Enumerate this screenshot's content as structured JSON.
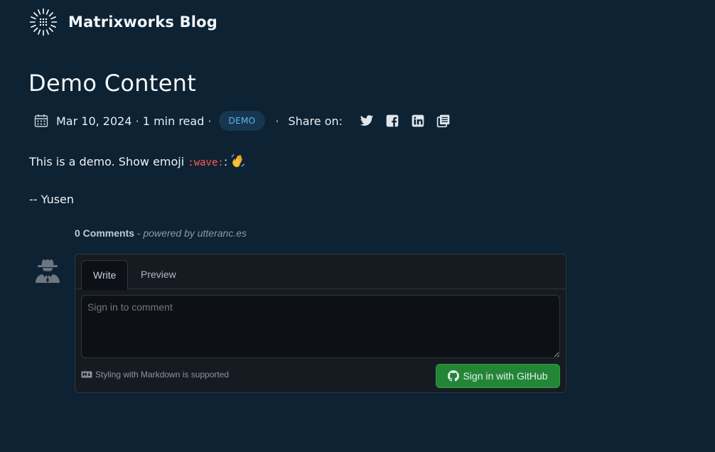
{
  "site": {
    "title": "Matrixworks Blog"
  },
  "post": {
    "title": "Demo Content",
    "date": "Mar 10, 2024",
    "read_time": "1 min read",
    "tag": "DEMO",
    "share_label": "Share on:",
    "share_icons": [
      "twitter-icon",
      "facebook-icon",
      "linkedin-icon",
      "copy-link-icon"
    ],
    "body": {
      "line1_text": "This is a demo. Show emoji ",
      "emoji_code": ":wave:",
      "emoji_colon": ":",
      "signature": "-- Yusen"
    }
  },
  "comments": {
    "count_label": "0 Comments",
    "powered_by": "- powered by utteranc.es",
    "tabs": [
      "Write",
      "Preview"
    ],
    "textarea_placeholder": "Sign in to comment",
    "markdown_note": "Styling with Markdown is supported",
    "signin_button": "Sign in with GitHub"
  },
  "colors": {
    "background": "#0d2232",
    "tag_bg": "#16374f",
    "tag_text": "#64b3ef",
    "emoji_code": "#ff5a57",
    "github_button": "#238636"
  }
}
